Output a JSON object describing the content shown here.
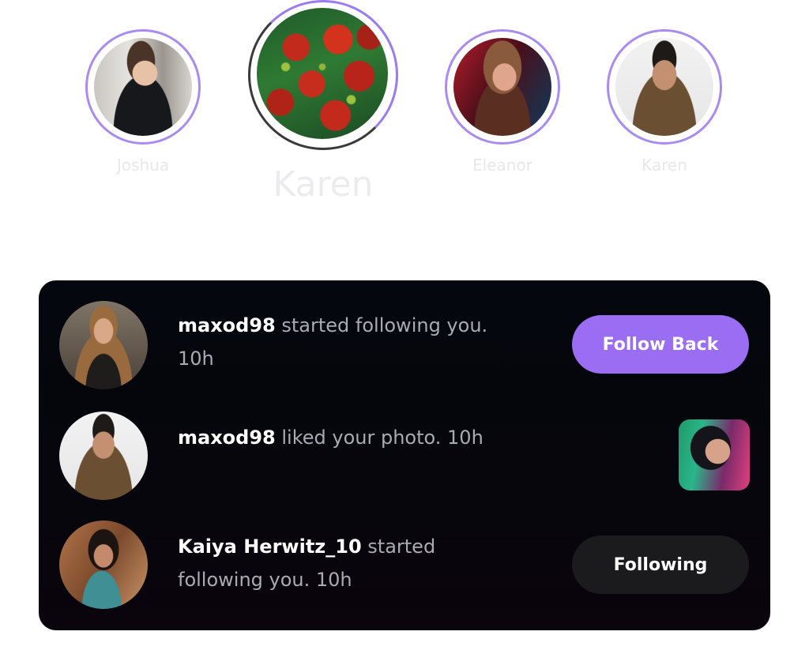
{
  "stories": [
    {
      "name": "Joshua",
      "avatar_icon": "woman-office-portrait",
      "state": "seen"
    },
    {
      "name": "Karen",
      "avatar_icon": "red-flowers-photo",
      "state": "active"
    },
    {
      "name": "Eleanor",
      "avatar_icon": "woman-neon-portrait",
      "state": "seen"
    },
    {
      "name": "Karen",
      "avatar_icon": "man-glasses-portrait",
      "state": "seen"
    }
  ],
  "notifications": [
    {
      "user": "maxod98",
      "message": " started following you. 10h",
      "avatar_icon": "woman-apron-portrait",
      "action_label": "Follow Back"
    },
    {
      "user": "maxod98",
      "message": " liked your photo. 10h",
      "avatar_icon": "man-glasses-portrait",
      "photo_icon": "woman-rgb-light-photo"
    },
    {
      "user": "Kaiya Herwitz_10",
      "message": " started following you. 10h",
      "avatar_icon": "woman-teal-top-portrait",
      "action_label": "Following"
    }
  ],
  "colors": {
    "accent": "#9a6df2",
    "story_ring": "#a98bf2",
    "card_bg": "#05070c",
    "following_button_bg": "#1b1b1d",
    "story_name": "#e8e8ea"
  }
}
